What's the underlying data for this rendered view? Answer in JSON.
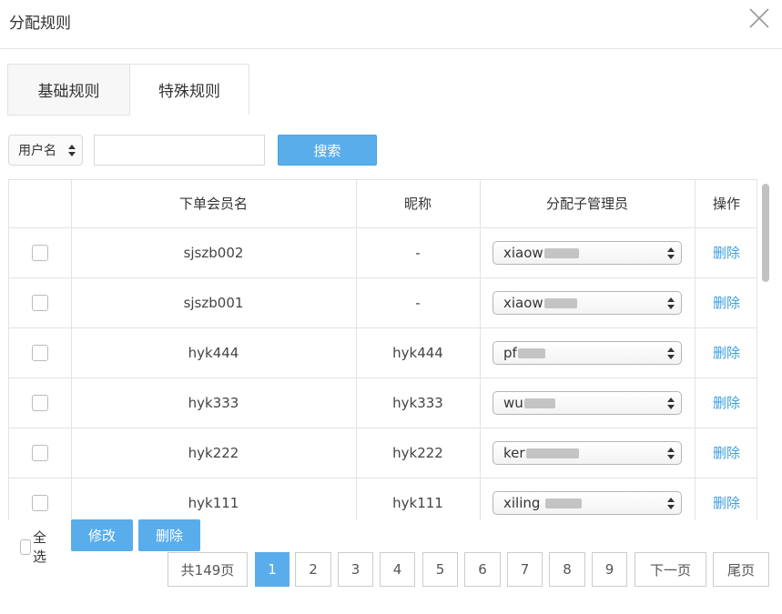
{
  "dialog": {
    "title": "分配规则"
  },
  "tabs": [
    {
      "label": "基础规则",
      "active": false
    },
    {
      "label": "特殊规则",
      "active": true
    }
  ],
  "search": {
    "field_select": "用户名",
    "input_value": "",
    "button_label": "搜索"
  },
  "table": {
    "headers": [
      "",
      "下单会员名",
      "昵称",
      "分配子管理员",
      "操作"
    ],
    "rows": [
      {
        "member": "sjszb002",
        "nickname": "-",
        "admin": "xiaow",
        "action": "删除"
      },
      {
        "member": "sjszb001",
        "nickname": "-",
        "admin": "xiaow",
        "action": "删除"
      },
      {
        "member": "hyk444",
        "nickname": "hyk444",
        "admin": "pf",
        "action": "删除"
      },
      {
        "member": "hyk333",
        "nickname": "hyk333",
        "admin": "wu",
        "action": "删除"
      },
      {
        "member": "hyk222",
        "nickname": "hyk222",
        "admin": "ker",
        "action": "删除"
      },
      {
        "member": "hyk111",
        "nickname": "hyk111",
        "admin": "xiling",
        "action": "删除"
      }
    ]
  },
  "footer": {
    "select_all": "全选",
    "edit_label": "修改",
    "delete_label": "删除"
  },
  "pagination": {
    "total": "共149页",
    "pages": [
      "1",
      "2",
      "3",
      "4",
      "5",
      "6",
      "7",
      "8",
      "9"
    ],
    "current": "1",
    "next": "下一页",
    "last": "尾页"
  },
  "colors": {
    "accent": "#5aadeb",
    "link": "#3b9fe0",
    "border": "#e3e3e3"
  }
}
